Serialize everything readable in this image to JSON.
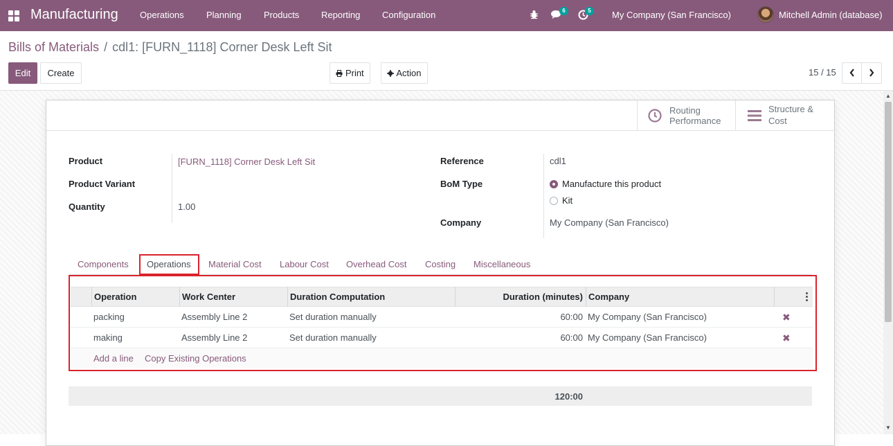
{
  "navbar": {
    "app_name": "Manufacturing",
    "menu": [
      "Operations",
      "Planning",
      "Products",
      "Reporting",
      "Configuration"
    ],
    "messages_count": "6",
    "activities_count": "5",
    "company": "My Company (San Francisco)",
    "user": "Mitchell Admin (database)",
    "accent_color": "#875a7b",
    "badge_color": "#00a09d"
  },
  "breadcrumb": {
    "parent": "Bills of Materials",
    "separator": "/",
    "current": "cdl1: [FURN_1118] Corner Desk Left Sit"
  },
  "toolbar": {
    "edit_label": "Edit",
    "create_label": "Create",
    "print_label": "Print",
    "action_label": "Action"
  },
  "pager": {
    "value": "15 / 15"
  },
  "smart_buttons": {
    "routing_line1": "Routing",
    "routing_line2": "Performance",
    "structure_line1": "Structure &",
    "structure_line2": "Cost"
  },
  "form": {
    "product_label": "Product",
    "product_value": "[FURN_1118] Corner Desk Left Sit",
    "variant_label": "Product Variant",
    "variant_value": "",
    "quantity_label": "Quantity",
    "quantity_value": "1.00",
    "reference_label": "Reference",
    "reference_value": "cdl1",
    "bom_type_label": "BoM Type",
    "bom_type_options": [
      "Manufacture this product",
      "Kit"
    ],
    "bom_type_selected": "Manufacture this product",
    "company_label": "Company",
    "company_value": "My Company (San Francisco)"
  },
  "tabs": [
    "Components",
    "Operations",
    "Material Cost",
    "Labour Cost",
    "Overhead Cost",
    "Costing",
    "Miscellaneous"
  ],
  "active_tab": "Operations",
  "operations_table": {
    "columns": [
      "Operation",
      "Work Center",
      "Duration Computation",
      "Duration (minutes)",
      "Company"
    ],
    "rows": [
      {
        "operation": "packing",
        "work_center": "Assembly Line 2",
        "duration_computation": "Set duration manually",
        "duration": "60:00",
        "company": "My Company (San Francisco)"
      },
      {
        "operation": "making",
        "work_center": "Assembly Line 2",
        "duration_computation": "Set duration manually",
        "duration": "60:00",
        "company": "My Company (San Francisco)"
      }
    ],
    "add_line_label": "Add a line",
    "copy_operations_label": "Copy Existing Operations",
    "total_duration": "120:00"
  }
}
